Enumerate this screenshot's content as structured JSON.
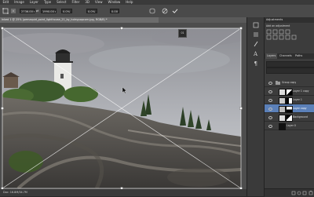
{
  "menu": [
    "Edit",
    "Image",
    "Layer",
    "Type",
    "Select",
    "Filter",
    "3D",
    "View",
    "Window",
    "Help"
  ],
  "options": {
    "width_value": "2736.00 px",
    "swap_symbol": "⇄",
    "height_value": "1990.00 px",
    "percent_a": "0.0%",
    "percent_b": "0.0%",
    "percent_c": "0.00"
  },
  "doc_tab_title": "Inked 1 @ 25% (pemaquid_point_lighthouse_21_by_holeypopcorn.jpg, RGB/8) *",
  "status_text": "Doc: 16.8M/34.7M",
  "canvas_badge": "01",
  "panels": {
    "adjustments_title": "Adjustments",
    "adjustments_sub": "Add an adjustment",
    "layer_tabs": [
      "Layers",
      "Channels",
      "Paths"
    ],
    "layers": [
      {
        "name": "Group copy",
        "type": "group"
      },
      {
        "name": "Layer 1 copy",
        "type": "mask"
      },
      {
        "name": "Layer 1",
        "type": "mask"
      },
      {
        "name": "Layer copy",
        "type": "mask",
        "selected": true
      },
      {
        "name": "Background",
        "type": "mask"
      },
      {
        "name": "Layer 0",
        "type": "dark"
      }
    ]
  },
  "colors": {
    "selected_layer": "#5b80b8",
    "transform_line": "#ffffff"
  }
}
